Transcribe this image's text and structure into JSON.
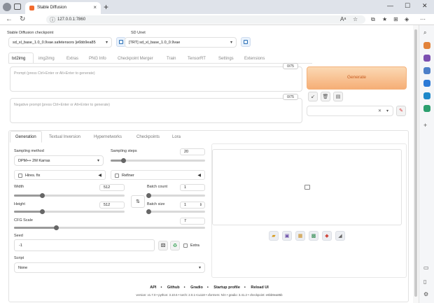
{
  "browser": {
    "tab_title": "Stable Diffusion",
    "url": "127.0.0.1:7860",
    "tab_close": "×",
    "new_tab": "+"
  },
  "top": {
    "checkpoint_label": "Stable Diffusion checkpoint",
    "checkpoint_value": "sd_xl_base_1.0_0.9vae.safetensors [e6bb9ea85",
    "unet_label": "SD Unet",
    "unet_value": "[TRT] sd_xl_base_1.0_0.9vae"
  },
  "main_tabs": [
    "txt2img",
    "img2img",
    "Extras",
    "PNG Info",
    "Checkpoint Merger",
    "Train",
    "TensorRT",
    "Settings",
    "Extensions"
  ],
  "prompt": {
    "placeholder": "Prompt (press Ctrl+Enter or Alt+Enter to generate)",
    "counter": "0/75"
  },
  "negative_prompt": {
    "placeholder": "Negative prompt (press Ctrl+Enter or Alt+Enter to generate)",
    "counter": "0/75"
  },
  "generate_label": "Generate",
  "sub_tabs": [
    "Generation",
    "Textual Inversion",
    "Hypernetworks",
    "Checkpoints",
    "Lora"
  ],
  "generation": {
    "sampling_method_label": "Sampling method",
    "sampling_method_value": "DPM++ 2M Karras",
    "sampling_steps_label": "Sampling steps",
    "sampling_steps_value": "20",
    "sampling_steps_fraction": 0.13,
    "hires_label": "Hires. fix",
    "refiner_label": "Refiner",
    "width_label": "Width",
    "width_value": "512",
    "width_fraction": 0.25,
    "height_label": "Height",
    "height_value": "512",
    "height_fraction": 0.25,
    "batch_count_label": "Batch count",
    "batch_count_value": "1",
    "batch_size_label": "Batch size",
    "batch_size_value": "1",
    "cfg_label": "CFG Scale",
    "cfg_value": "7",
    "cfg_fraction": 0.22,
    "seed_label": "Seed",
    "seed_value": "-1",
    "extra_label": "Extra",
    "script_label": "Script",
    "script_value": "None"
  },
  "footer": {
    "links": [
      "API",
      "Github",
      "Gradio",
      "Startup profile",
      "Reload UI"
    ],
    "separator": "•",
    "version_line": "version: v1.7.0  •  python: 3.10.6  •  torch: 2.0.1+cu118  •  xformers: N/A  •  gradio: 3.41.2  •  checkpoint: e6bb9ea85b"
  }
}
